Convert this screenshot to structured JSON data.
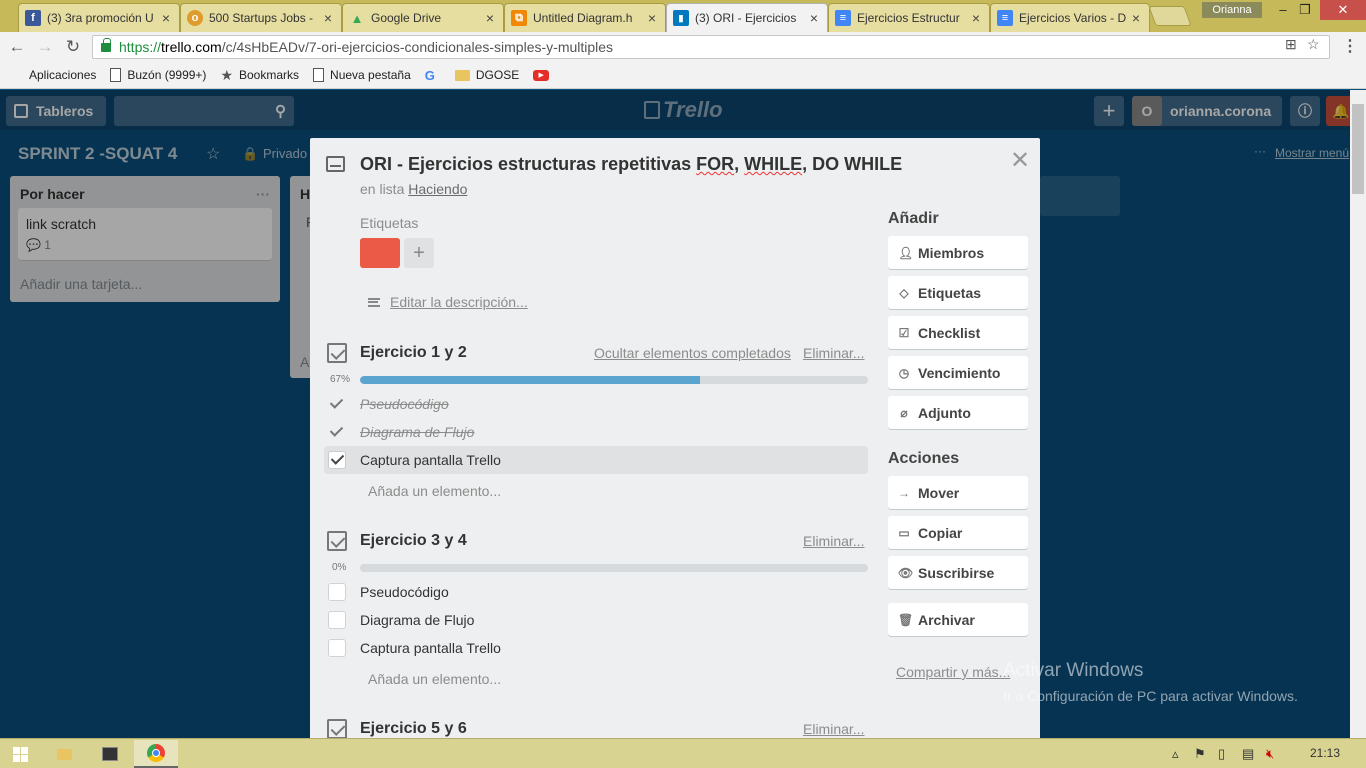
{
  "browser": {
    "tabs": [
      {
        "title": "(3) 3ra promoción U",
        "favicon": "facebook-icon",
        "color": "#3b5998",
        "glyph": "f"
      },
      {
        "title": "500 Startups Jobs -",
        "favicon": "hexagon-icon",
        "color": "#e09b2d",
        "glyph": "o"
      },
      {
        "title": "Google Drive",
        "favicon": "drive-icon",
        "color": "#34a853",
        "glyph": "▲"
      },
      {
        "title": "Untitled Diagram.h",
        "favicon": "drawio-icon",
        "color": "#f08705",
        "glyph": "⧉"
      },
      {
        "title": "(3) ORI - Ejercicios",
        "favicon": "trello-icon",
        "color": "#0079bf",
        "glyph": "▮"
      },
      {
        "title": "Ejercicios Estructur",
        "favicon": "docs-icon",
        "color": "#4285f4",
        "glyph": "≡"
      },
      {
        "title": "Ejercicios Varios - D",
        "favicon": "docs-icon",
        "color": "#4285f4",
        "glyph": "≡"
      }
    ],
    "active_tab": 4,
    "profile": "Orianna",
    "url_secure": "https://",
    "url_host": "trello.com",
    "url_path": "/c/4sHbEADv/7-ori-ejercicios-condicionales-simples-y-multiples",
    "bookmarks": [
      "Aplicaciones",
      "Buzón (9999+)",
      "Bookmarks",
      "Nueva pestaña",
      "DGOSE"
    ]
  },
  "trello": {
    "boards_label": "Tableros",
    "logo": "Trello",
    "user_initial": "O",
    "username": "orianna.corona",
    "board_name": "SPRINT 2 -SQUAT 4",
    "visibility": "Privado",
    "show_menu": "Mostrar menú",
    "lists": [
      {
        "name": "Por hacer",
        "cards": [
          {
            "title": "link scratch",
            "comments": "1"
          }
        ],
        "add_card": "Añadir una tarjeta..."
      },
      {
        "name": "H",
        "first_card": "P",
        "add_fragment": "A"
      }
    ]
  },
  "modal": {
    "title_pre": "ORI - Ejercicios estructuras repetitivas ",
    "title_for": "FOR",
    "title_sep1": ", ",
    "title_while": "WHILE",
    "title_post": ", DO WHILE",
    "in_list_prefix": "en lista",
    "list_name": "Haciendo",
    "labels_heading": "Etiquetas",
    "label_color": "#eb5a46",
    "edit_description": "Editar la descripción...",
    "checklists": [
      {
        "title": "Ejercicio 1 y 2",
        "hide_completed": "Ocultar elementos completados",
        "delete": "Eliminar...",
        "percent": "67%",
        "progress": 0.67,
        "items": [
          {
            "text": "Pseudocódigo",
            "done": true
          },
          {
            "text": "Diagrama de Flujo",
            "done": true
          },
          {
            "text": "Captura pantalla Trello",
            "done": true
          }
        ],
        "add_item": "Añada un elemento..."
      },
      {
        "title": "Ejercicio 3 y 4",
        "delete": "Eliminar...",
        "percent": "0%",
        "progress": 0,
        "items": [
          {
            "text": "Pseudocódigo",
            "done": false
          },
          {
            "text": "Diagrama de Flujo",
            "done": false
          },
          {
            "text": "Captura pantalla Trello",
            "done": false
          }
        ],
        "add_item": "Añada un elemento..."
      },
      {
        "title": "Ejercicio 5 y 6",
        "delete": "Eliminar..."
      }
    ],
    "sidebar": {
      "add_heading": "Añadir",
      "add_buttons": [
        "Miembros",
        "Etiquetas",
        "Checklist",
        "Vencimiento",
        "Adjunto"
      ],
      "actions_heading": "Acciones",
      "action_buttons": [
        "Mover",
        "Copiar",
        "Suscribirse",
        "Archivar"
      ],
      "share": "Compartir y más..."
    }
  },
  "watermark": {
    "line1": "Activar Windows",
    "line2": "Ir a Configuración de PC para activar Windows."
  },
  "taskbar": {
    "clock": "21:13"
  }
}
